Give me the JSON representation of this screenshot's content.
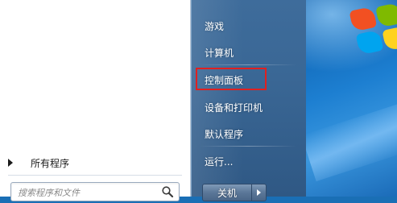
{
  "start_menu": {
    "all_programs_label": "所有程序",
    "search": {
      "placeholder": "搜索程序和文件"
    },
    "right_items": [
      {
        "label": "游戏"
      },
      {
        "label": "计算机"
      },
      {
        "label": "控制面板",
        "highlighted": true
      },
      {
        "label": "设备和打印机"
      },
      {
        "label": "默认程序"
      },
      {
        "label": "运行..."
      }
    ],
    "shutdown_label": "关机"
  },
  "colors": {
    "right_pane": "#3a6795",
    "highlight_border": "#e02020"
  },
  "icons": [
    "search-icon",
    "all-programs-arrow-icon",
    "shutdown-options-arrow-icon",
    "windows-logo-icon"
  ]
}
